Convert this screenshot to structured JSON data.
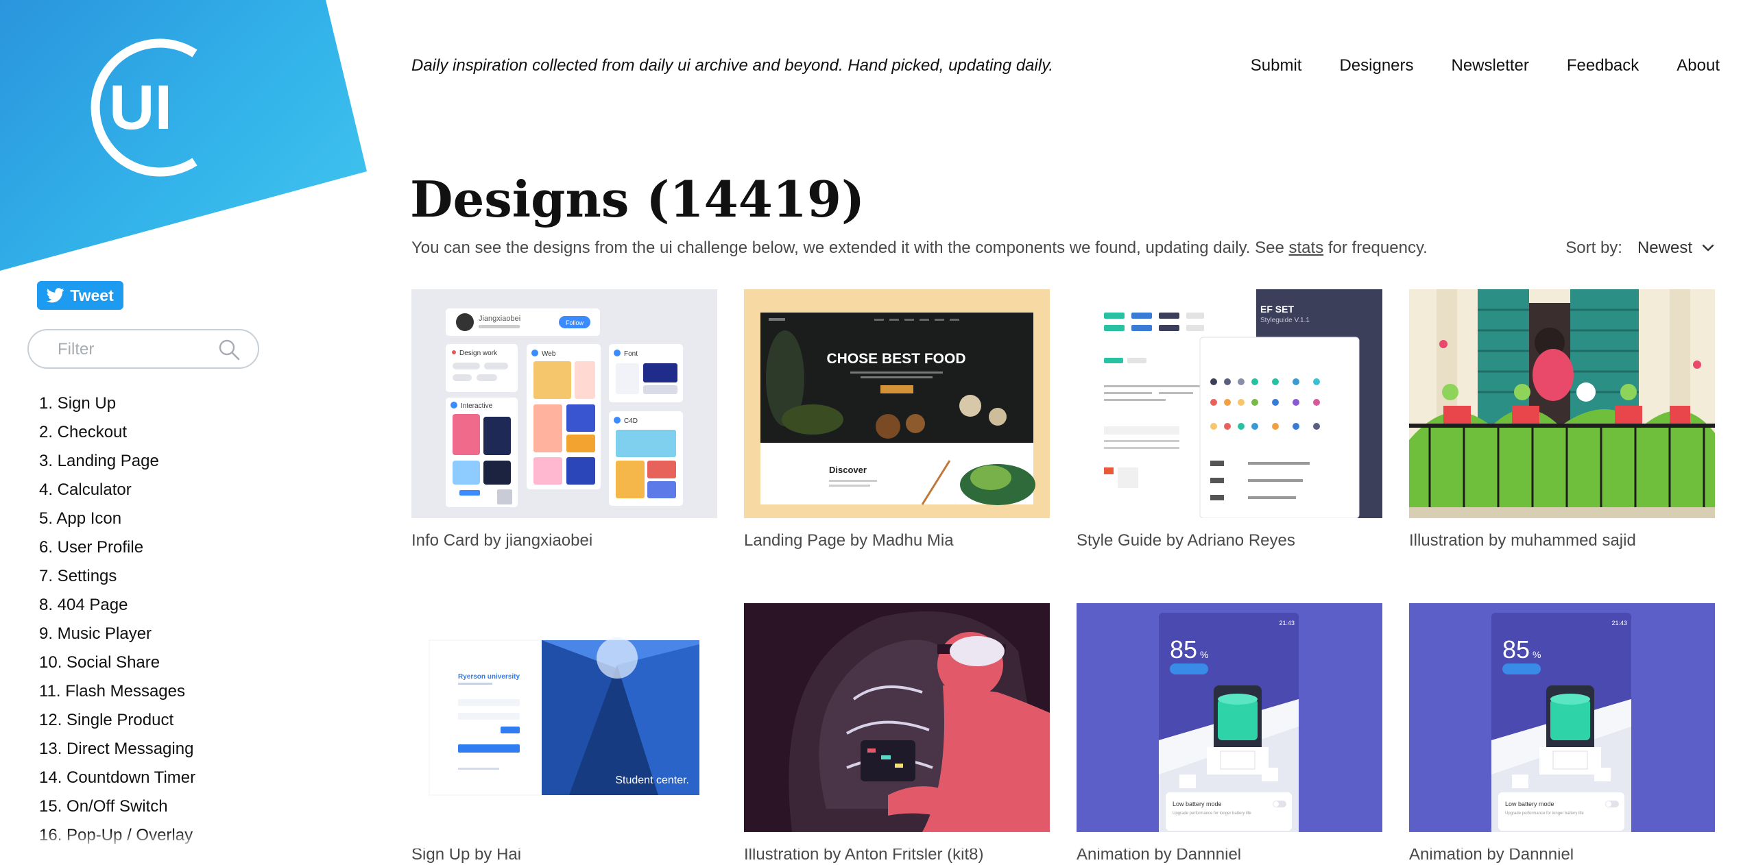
{
  "brand": {
    "logo_text": "UI",
    "colors": {
      "primary": "#2a95dd",
      "accent": "#45c8f0"
    }
  },
  "tweet": {
    "label": "Tweet",
    "icon": "twitter-bird-icon"
  },
  "filter": {
    "placeholder": "Filter",
    "value": "",
    "icon": "search-icon"
  },
  "sidebar": {
    "items": [
      "1. Sign Up",
      "2. Checkout",
      "3. Landing Page",
      "4. Calculator",
      "5. App Icon",
      "6. User Profile",
      "7. Settings",
      "8. 404 Page",
      "9. Music Player",
      "10. Social Share",
      "11. Flash Messages",
      "12. Single Product",
      "13. Direct Messaging",
      "14. Countdown Timer",
      "15. On/Off Switch",
      "16. Pop-Up / Overlay"
    ]
  },
  "header": {
    "tagline": "Daily inspiration collected from daily ui archive and beyond. Hand picked, updating daily.",
    "nav": [
      "Submit",
      "Designers",
      "Newsletter",
      "Feedback",
      "About"
    ]
  },
  "main": {
    "title": "Designs (14419)",
    "subtitle_before": "You can see the designs from the ui challenge below, we extended it with the components we found, updating daily. See ",
    "subtitle_link": "stats",
    "subtitle_after": " for frequency.",
    "sort": {
      "label": "Sort by:",
      "value": "Newest",
      "icon": "chevron-down-icon"
    },
    "cards": [
      {
        "title": "Info Card by jiangxiaobei",
        "thumb": {
          "profile_name": "Jiangxiaobei",
          "follow_label": "Follow",
          "labels": [
            "Design work",
            "Web",
            "Font",
            "Interactive",
            "C4D"
          ],
          "colors": {
            "bg": "#e8eaef",
            "accent": "#3b8bff"
          }
        }
      },
      {
        "title": "Landing Page by Madhu Mia",
        "thumb": {
          "headline": "CHOSE BEST FOOD",
          "section_label": "Discover",
          "colors": {
            "bg": "#f7d9a4",
            "hero": "#1b1d1c",
            "accent": "#d49238"
          }
        }
      },
      {
        "title": "Style Guide by Adriano Reyes",
        "thumb": {
          "header_title": "EF SET",
          "header_subtitle": "Styleguide V.1.1",
          "colors": {
            "bg": "#3c3f59",
            "sheet": "#ffffff",
            "accent": "#28c2a2"
          }
        }
      },
      {
        "title": "Illustration by muhammed sajid",
        "thumb": {
          "colors": {
            "bg": "#f3ecd9",
            "shutter": "#2c8f86",
            "pot": "#e8464b",
            "plant": "#6fbf3c"
          }
        }
      },
      {
        "title": "Sign Up by Hai",
        "thumb": {
          "heading": "Ryerson university",
          "photo_caption": "Student center.",
          "colors": {
            "bg": "#ffffff",
            "accent": "#2f7df0",
            "photo": "#1f4fa8"
          }
        }
      },
      {
        "title": "Illustration by Anton Fritsler (kit8)",
        "thumb": {
          "colors": {
            "bg": "#2a1426",
            "skin": "#e25a6a",
            "glass": "#3a2637"
          }
        }
      },
      {
        "title": "Animation by Dannniel",
        "thumb": {
          "percent": "85",
          "unit": "%",
          "status_time": "21:43",
          "panel_title": "Low battery mode",
          "panel_subtitle": "Upgrade performance for longer battery life",
          "colors": {
            "bg": "#5b5fc7",
            "battery": "#2ed3a8"
          }
        }
      },
      {
        "title": "Animation by Dannniel",
        "thumb": {
          "percent": "85",
          "unit": "%",
          "status_time": "21:43",
          "panel_title": "Low battery mode",
          "panel_subtitle": "Upgrade performance for longer battery life",
          "colors": {
            "bg": "#5b5fc7",
            "battery": "#2ed3a8"
          }
        }
      }
    ]
  }
}
